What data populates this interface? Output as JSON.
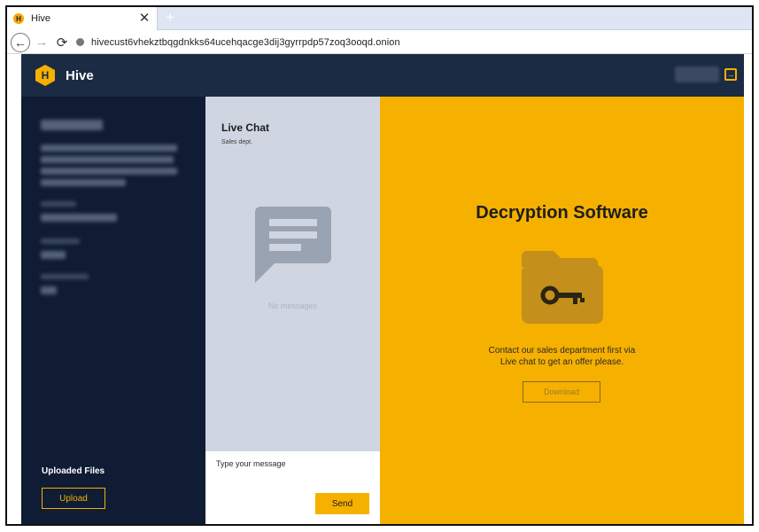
{
  "browser": {
    "tab_title": "Hive",
    "tab_favicon_letter": "H",
    "close_glyph": "✕",
    "new_tab_glyph": "+",
    "url": "hivecust6vhekztbqgdnkks64ucehqacge3dij3gyrrpdp57zoq3ooqd.onion",
    "back_glyph": "←",
    "forward_glyph": "→",
    "reload_glyph": "⟳"
  },
  "app": {
    "logo_letter": "H",
    "name": "Hive",
    "logout_glyph": "→"
  },
  "sidebar": {
    "uploaded_files_label": "Uploaded Files",
    "upload_label": "Upload"
  },
  "chat": {
    "title": "Live Chat",
    "subtitle": "Sales dept.",
    "empty_text": "No messages",
    "input_placeholder": "Type your message",
    "send_label": "Send"
  },
  "decryption": {
    "title": "Decryption Software",
    "message_line1": "Contact our sales department first via",
    "message_line2": "Live chat to get an offer please.",
    "download_label": "Download"
  },
  "colors": {
    "header_bg": "#1b2b44",
    "sidebar_bg": "#0f1c33",
    "chat_bg": "#cfd6e2",
    "accent": "#f5b000"
  }
}
